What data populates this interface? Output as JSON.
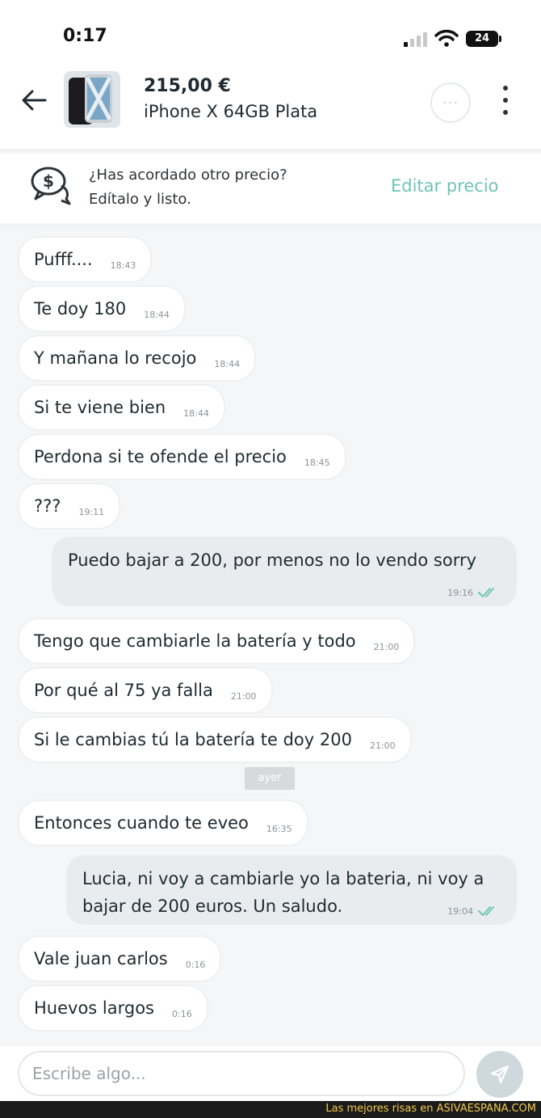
{
  "status_bar": {
    "time": "0:17",
    "battery": "24"
  },
  "header": {
    "price": "215,00 €",
    "title": "iPhone X 64GB Plata",
    "more_label": "···"
  },
  "banner": {
    "question": "¿Has acordado otro precio?",
    "subtitle": "Edítalo y listo.",
    "action": "Editar precio"
  },
  "messages": [
    {
      "text": "Pufff....",
      "time": "18:43",
      "direction": "in"
    },
    {
      "text": "Te doy 180",
      "time": "18:44",
      "direction": "in"
    },
    {
      "text": "Y mañana lo recojo",
      "time": "18:44",
      "direction": "in"
    },
    {
      "text": "Si te viene bien",
      "time": "18:44",
      "direction": "in"
    },
    {
      "text": "Perdona si te ofende el precio",
      "time": "18:45",
      "direction": "in"
    },
    {
      "text": "???",
      "time": "19:11",
      "direction": "in"
    },
    {
      "text": "Puedo bajar a 200, por menos no lo vendo sorry",
      "time": "19:16",
      "direction": "out",
      "read": true
    },
    {
      "text": "Tengo que cambiarle la batería y todo",
      "time": "21:00",
      "direction": "in"
    },
    {
      "text": "Por qué al 75 ya falla",
      "time": "21:00",
      "direction": "in"
    },
    {
      "text": "Si le cambias tú la batería te doy 200",
      "time": "21:00",
      "direction": "in"
    },
    {
      "text": "Entonces cuando te eveo",
      "time": "16:35",
      "direction": "in"
    },
    {
      "text": "Lucia, ni voy a cambiarle yo la bateria, ni voy a bajar de 200 euros. Un saludo.",
      "time": "19:04",
      "direction": "out",
      "read": true
    },
    {
      "text": "Vale juan carlos",
      "time": "0:16",
      "direction": "in"
    },
    {
      "text": "Huevos largos",
      "time": "0:16",
      "direction": "in"
    }
  ],
  "day_separator": "ayer",
  "composer": {
    "placeholder": "Escribe algo..."
  },
  "footer": {
    "text": "Las mejores risas en ASIVAESPANA.COM"
  },
  "colors": {
    "accent": "#6fc4b6",
    "chat_bg": "#f5f6f7",
    "out_bubble": "#e9ecee",
    "read_ticks": "#6fc4b6"
  }
}
